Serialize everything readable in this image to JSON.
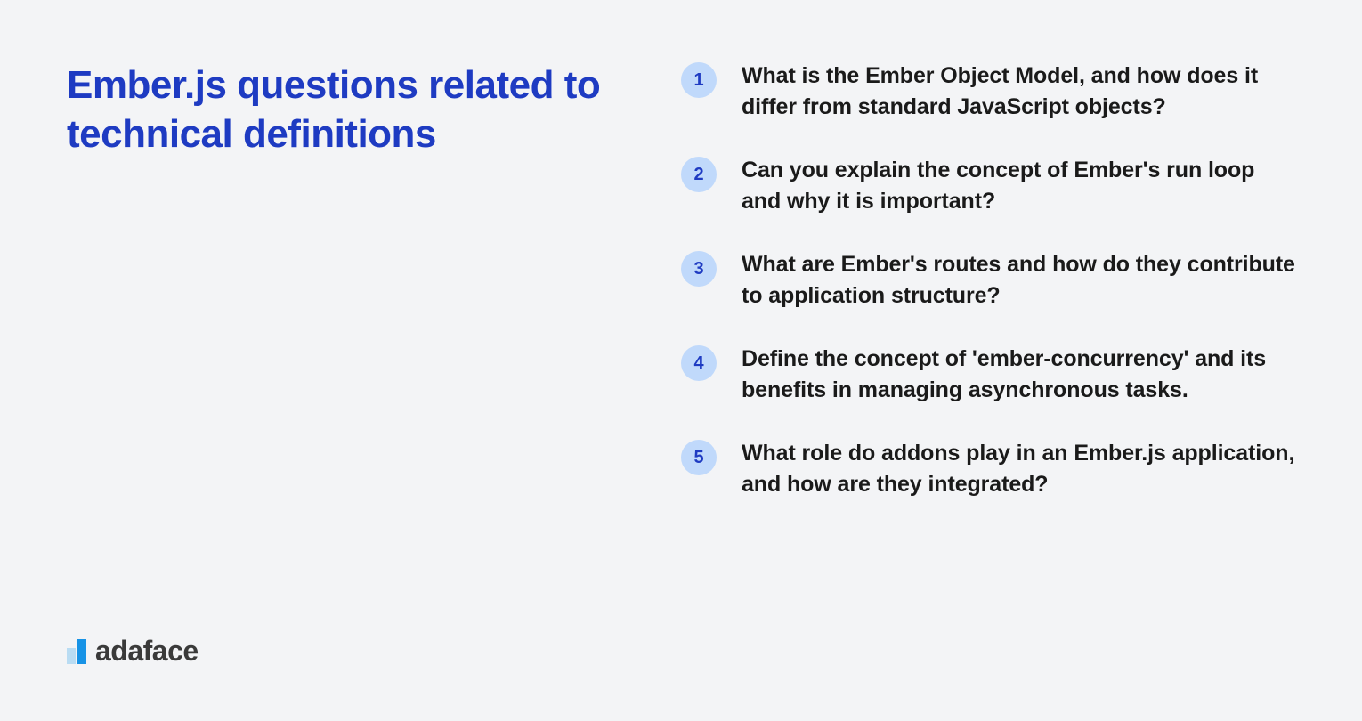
{
  "title": "Ember.js questions related to technical definitions",
  "logo_text": "adaface",
  "questions": [
    {
      "num": "1",
      "text": "What is the Ember Object Model, and how does it differ from standard JavaScript objects?"
    },
    {
      "num": "2",
      "text": "Can you explain the concept of Ember's run loop and why it is important?"
    },
    {
      "num": "3",
      "text": "What are Ember's routes and how do they contribute to application structure?"
    },
    {
      "num": "4",
      "text": "Define the concept of 'ember-concurrency' and its benefits in managing asynchronous tasks."
    },
    {
      "num": "5",
      "text": "What role do addons play in an Ember.js application, and how are they integrated?"
    }
  ]
}
